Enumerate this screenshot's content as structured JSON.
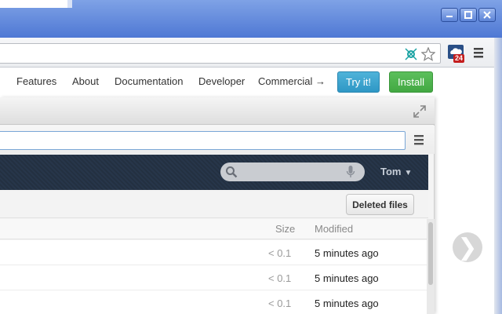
{
  "window": {
    "minimize_label": "minimize",
    "maximize_label": "maximize",
    "close_label": "close"
  },
  "browser": {
    "extension_badge": "24",
    "accent": "#4e78d4"
  },
  "site_nav": {
    "links": [
      "Features",
      "About",
      "Documentation",
      "Developer",
      "Commercial →"
    ],
    "try_label": "Try it!",
    "install_label": "Install",
    "try_color": "#2f97c5",
    "install_color": "#43a843"
  },
  "app": {
    "user_label": "Tom",
    "user_caret": "▼",
    "deleted_files_label": "Deleted files",
    "columns": {
      "size": "Size",
      "modified": "Modified"
    },
    "rows": [
      {
        "size": "< 0.1",
        "modified": "5 minutes ago"
      },
      {
        "size": "< 0.1",
        "modified": "5 minutes ago"
      },
      {
        "size": "< 0.1",
        "modified": "5 minutes ago"
      }
    ],
    "next_arrow": "❯"
  }
}
